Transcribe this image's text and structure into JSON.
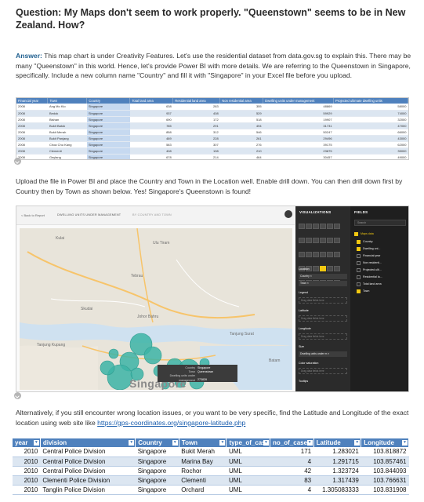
{
  "question": "Question: My Maps don't seem to work properly. \"Queenstown\" seems to be in New Zealand. How?",
  "answer": {
    "label": "Answer:",
    "text": " This map chart is under Creativity Features. Let's use the residential dataset from data.gov.sg to explain this. There may be many \"Queenstown\" in this world. Hence, let's provide Power BI with more details. We are referring to the Queenstown in Singapore, specifically. Include a new column name \"Country\" and fill it with \"Singapore\" in your Excel file before you upload."
  },
  "excel_preview": {
    "headers": [
      "Financial year",
      "Town",
      "Country",
      "Total land area",
      "Residential land area",
      "Non residential area",
      "Dwelling units under management",
      "Projected ultimate dwelling units"
    ],
    "rows": [
      [
        "2008",
        "Ang Mo Kio",
        "Singapore",
        "638",
        "283",
        "355",
        "48869",
        "58000"
      ],
      [
        "2008",
        "Bedok",
        "Singapore",
        "937",
        "408",
        "529",
        "59929",
        "74000"
      ],
      [
        "2008",
        "Bishan",
        "Singapore",
        "690",
        "172",
        "518",
        "19907",
        "32000"
      ],
      [
        "2008",
        "Bukit Batok",
        "Singapore",
        "785",
        "291",
        "494",
        "31731",
        "47000"
      ],
      [
        "2008",
        "Bukit Merah",
        "Singapore",
        "858",
        "312",
        "546",
        "50247",
        "66000"
      ],
      [
        "2008",
        "Bukit Panjang",
        "Singapore",
        "489",
        "228",
        "261",
        "29496",
        "43000"
      ],
      [
        "2008",
        "Choa Chu Kang",
        "Singapore",
        "583",
        "307",
        "276",
        "39175",
        "62000"
      ],
      [
        "2008",
        "Clementi",
        "Singapore",
        "408",
        "198",
        "210",
        "23875",
        "35000"
      ],
      [
        "2008",
        "Geylang",
        "Singapore",
        "678",
        "214",
        "464",
        "30457",
        "49000"
      ]
    ]
  },
  "paragraph2": "Upload the file in Power BI and place the Country and Town in the Location well. Enable drill down. You can then drill down first by Country then by Town as shown below. Yes! Singapore's Queenstown is found!",
  "powerbi": {
    "back": "< Back to Report",
    "visual_title": "DWELLING UNITS UNDER MANAGEMENT",
    "visual_subtitle": "BY COUNTRY AND TOWN",
    "map_labels": {
      "kulai": "Kulai",
      "ulu_tiram": "Ulu Tiram",
      "tebrau": "Tebrau",
      "skudai": "Skudai",
      "johor_bahru": "Johor Bahru",
      "tanjung_kupang": "Tanjung Kupang",
      "tanjung_surat": "Tanjung Surat",
      "singapore": "Singapore",
      "batam": "Batam"
    },
    "tooltip": {
      "rows": [
        {
          "label": "Country",
          "value": "Singapore"
        },
        {
          "label": "Town",
          "value": "Queenstown"
        },
        {
          "label": "Dwelling units under management",
          "value": "273839"
        }
      ]
    },
    "viz_pane": {
      "title": "VISUALIZATIONS",
      "wells": [
        {
          "label": "Location",
          "fields": [
            "Country",
            "Town"
          ]
        },
        {
          "label": "Legend",
          "drop": "Drag data fields here"
        },
        {
          "label": "Latitude",
          "drop": "Drag data fields here"
        },
        {
          "label": "Longitude",
          "drop": "Drag data fields here"
        },
        {
          "label": "Size",
          "fields": [
            "Dwelling units under m"
          ]
        },
        {
          "label": "Color saturation",
          "drop": "Drag data fields here"
        },
        {
          "label": "Tooltips",
          "drop": ""
        }
      ]
    },
    "fields_pane": {
      "title": "FIELDS",
      "search": "Search",
      "table": "Maps data",
      "fields": [
        {
          "name": "Country",
          "checked": true
        },
        {
          "name": "Dwelling uni...",
          "checked": true
        },
        {
          "name": "Financial year",
          "checked": false
        },
        {
          "name": "Non residenti...",
          "checked": false
        },
        {
          "name": "Projected ulti...",
          "checked": false
        },
        {
          "name": "Residential la...",
          "checked": false
        },
        {
          "name": "Total land area",
          "checked": false
        },
        {
          "name": "Town",
          "checked": true
        }
      ]
    }
  },
  "paragraph3": {
    "text": "Alternatively, if you still encounter wrong location issues, or you want to be very specific, find the Latitude and Longitude of the exact location using web site like ",
    "link": "https://gps-coordinates.org/singapore-latitude.php"
  },
  "bottom_table": {
    "headers": [
      "year",
      "division",
      "Country",
      "Town",
      "type_of_case",
      "no_of_cases",
      "Latitude",
      "Longitude"
    ],
    "rows": [
      [
        "2010",
        "Central Police Division",
        "Singapore",
        "Bukit Merah",
        "UML",
        "171",
        "1.283021",
        "103.818872"
      ],
      [
        "2010",
        "Central Police Division",
        "Singapore",
        "Marina Bay",
        "UML",
        "4",
        "1.291715",
        "103.857461"
      ],
      [
        "2010",
        "Central Police Division",
        "Singapore",
        "Rochor",
        "UML",
        "42",
        "1.323724",
        "103.844093"
      ],
      [
        "2010",
        "Clementi Police Division",
        "Singapore",
        "Clementi",
        "UML",
        "83",
        "1.317439",
        "103.766631"
      ],
      [
        "2010",
        "Tanglin Police Division",
        "Singapore",
        "Orchard",
        "UML",
        "4",
        "1.305083333",
        "103.831908"
      ]
    ]
  },
  "colors": {
    "excel_header": "#4f81bd",
    "excel_band": "#dce6f1",
    "bubble": "#3cb4a6",
    "powerbi_accent": "#f2c811",
    "link": "#1a5dad"
  }
}
